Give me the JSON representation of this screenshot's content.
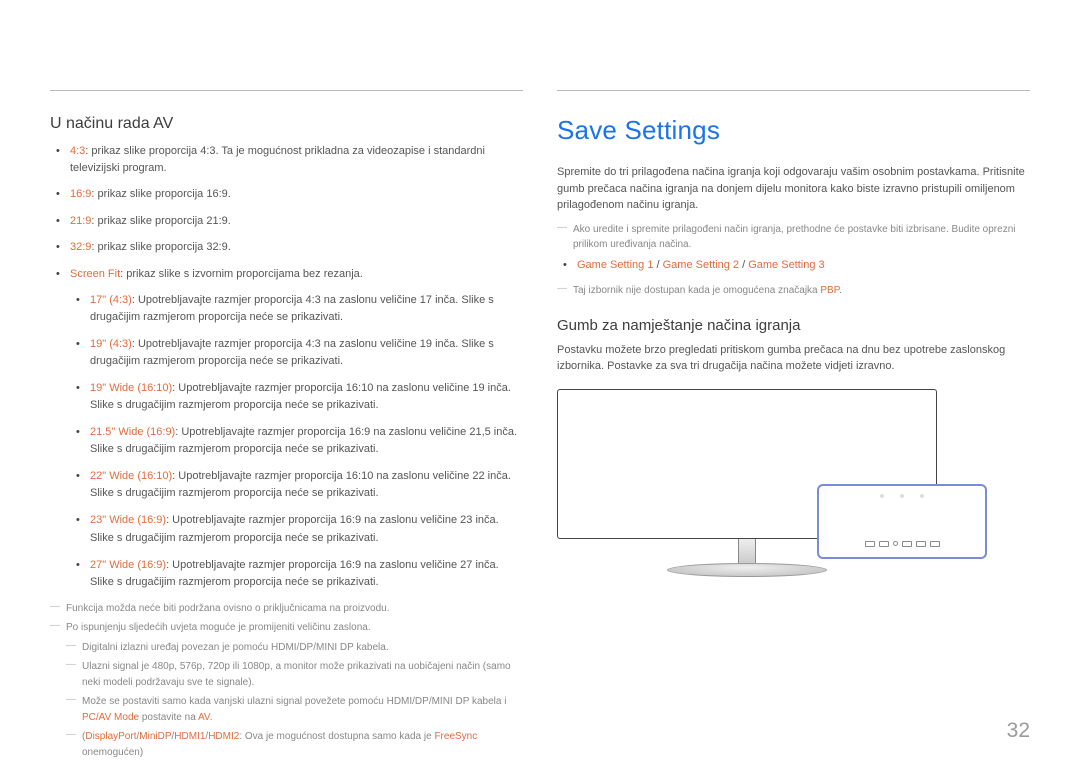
{
  "left": {
    "heading": "U načinu rada AV",
    "main_items": [
      {
        "label": "4:3",
        "text": ": prikaz slike proporcija 4:3. Ta je mogućnost prikladna za videozapise i standardni televizijski program."
      },
      {
        "label": "16:9",
        "text": ": prikaz slike proporcija 16:9."
      },
      {
        "label": "21:9",
        "text": ": prikaz slike proporcija 21:9."
      },
      {
        "label": "32:9",
        "text": ": prikaz slike proporcija 32:9."
      },
      {
        "label": "Screen Fit",
        "text": ": prikaz slike s izvornim proporcijama bez rezanja."
      }
    ],
    "sub_items": [
      {
        "label": "17\" (4:3)",
        "text": ": Upotrebljavajte razmjer proporcija 4:3 na zaslonu veličine 17 inča. Slike s drugačijim razmjerom proporcija neće se prikazivati."
      },
      {
        "label": "19\" (4:3)",
        "text": ": Upotrebljavajte razmjer proporcija 4:3 na zaslonu veličine 19 inča. Slike s drugačijim razmjerom proporcija neće se prikazivati."
      },
      {
        "label": "19\" Wide (16:10)",
        "text": ": Upotrebljavajte razmjer proporcija 16:10 na zaslonu veličine 19 inča. Slike s drugačijim razmjerom proporcija neće se prikazivati."
      },
      {
        "label": "21.5\" Wide (16:9)",
        "text": ": Upotrebljavajte razmjer proporcija 16:9 na zaslonu veličine 21,5 inča. Slike s drugačijim razmjerom proporcija neće se prikazivati."
      },
      {
        "label": "22\" Wide (16:10)",
        "text": ": Upotrebljavajte razmjer proporcija 16:10 na zaslonu veličine 22 inča. Slike s drugačijim razmjerom proporcija neće se prikazivati."
      },
      {
        "label": "23\" Wide (16:9)",
        "text": ": Upotrebljavajte razmjer proporcija 16:9 na zaslonu veličine 23 inča. Slike s drugačijim razmjerom proporcija neće se prikazivati."
      },
      {
        "label": "27\" Wide (16:9)",
        "text": ": Upotrebljavajte razmjer proporcija 16:9 na zaslonu veličine 27 inča. Slike s drugačijim razmjerom proporcija neće se prikazivati."
      }
    ],
    "note1": "Funkcija možda neće biti podržana ovisno o priključnicama na proizvodu.",
    "note2": "Po ispunjenju sljedećih uvjeta moguće je promijeniti veličinu zaslona.",
    "note2a": "Digitalni izlazni uređaj povezan je pomoću HDMI/DP/MINI DP kabela.",
    "note2b": "Ulazni signal je 480p, 576p, 720p ili 1080p, a monitor može prikazivati na uobičajeni način (samo neki modeli podržavaju sve te signale).",
    "note2c_pre": "Može se postaviti samo kada vanjski ulazni signal povežete pomoću HDMI/DP/MINI DP kabela i ",
    "note2c_hl1": "PC/AV Mode",
    "note2c_mid": " postavite na ",
    "note2c_hl2": "AV",
    "note2c_post": ".",
    "note2d_pre": "(",
    "note2d_hl1": "DisplayPort",
    "note2d_s": "/",
    "note2d_hl2": "MiniDP",
    "note2d_hl3": "HDMI1",
    "note2d_hl4": "HDMI2",
    "note2d_mid": ": Ova je mogućnost dostupna samo kada je ",
    "note2d_hl5": "FreeSync",
    "note2d_post": " onemogućen)"
  },
  "right": {
    "title": "Save Settings",
    "para1": "Spremite do tri prilagođena načina igranja koji odgovaraju vašim osobnim postavkama. Pritisnite gumb prečaca načina igranja na donjem dijelu monitora kako biste izravno pristupili omiljenom prilagođenom načinu igranja.",
    "note1": "Ako uredite i spremite prilagođeni način igranja, prethodne će postavke biti izbrisane. Budite oprezni prilikom uređivanja načina.",
    "modes_item": {
      "a": "Game Setting 1",
      "b": "Game Setting 2",
      "c": "Game Setting 3",
      "sep": " / "
    },
    "note2_pre": "Taj izbornik nije dostupan kada je omogućena značajka ",
    "note2_hl": "PBP",
    "note2_post": ".",
    "subheading": "Gumb za namještanje načina igranja",
    "para2": "Postavku možete brzo pregledati pritiskom gumba prečaca na dnu bez upotrebe zaslonskog izbornika. Postavke za sva tri drugačija načina možete vidjeti izravno."
  },
  "page_number": "32"
}
